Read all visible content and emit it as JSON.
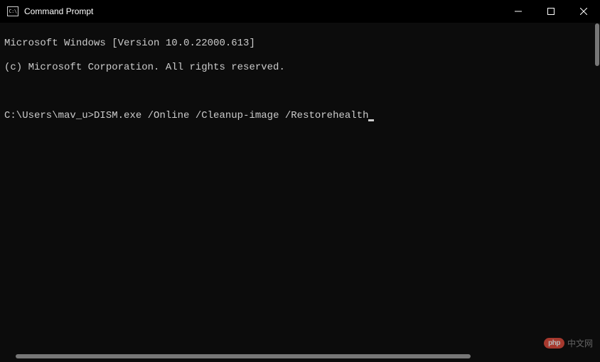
{
  "titlebar": {
    "icon_label": "C:\\",
    "title": "Command Prompt"
  },
  "terminal": {
    "line1": "Microsoft Windows [Version 10.0.22000.613]",
    "line2": "(c) Microsoft Corporation. All rights reserved.",
    "prompt_path": "C:\\Users\\mav_u>",
    "command": "DISM.exe /Online /Cleanup-image /Restorehealth"
  },
  "watermark": {
    "logo": "php",
    "text": "中文网"
  }
}
